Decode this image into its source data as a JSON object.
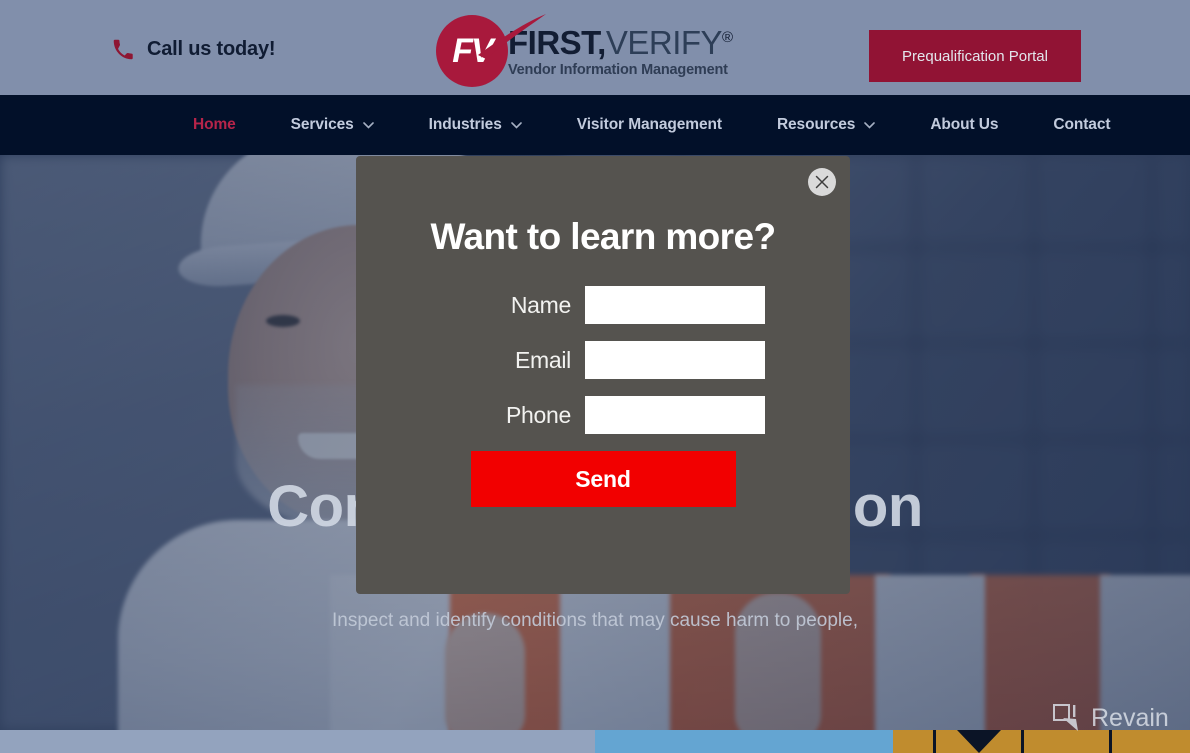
{
  "topbar": {
    "phone_icon": "phone-icon",
    "call_text": "Call us today!",
    "logo": {
      "badge_text": "FV",
      "line1_first": "FIRST,",
      "line1_second": "VERIFY",
      "registered": "®",
      "line2": "Vendor Information Management"
    },
    "prequalification_button": "Prequalification Portal"
  },
  "nav": {
    "items": [
      {
        "label": "Home",
        "has_dropdown": false,
        "active": true
      },
      {
        "label": "Services",
        "has_dropdown": true,
        "active": false
      },
      {
        "label": "Industries",
        "has_dropdown": true,
        "active": false
      },
      {
        "label": "Visitor Management",
        "has_dropdown": false,
        "active": false
      },
      {
        "label": "Resources",
        "has_dropdown": true,
        "active": false
      },
      {
        "label": "About Us",
        "has_dropdown": false,
        "active": false
      },
      {
        "label": "Contact",
        "has_dropdown": false,
        "active": false
      }
    ]
  },
  "hero": {
    "title": "Construction Inspection",
    "subtitle": "Inspect and identify conditions that may cause harm to people,"
  },
  "modal": {
    "title": "Want to learn more?",
    "close_icon": "close-icon",
    "fields": [
      {
        "label": "Name",
        "value": "",
        "placeholder": ""
      },
      {
        "label": "Email",
        "value": "",
        "placeholder": ""
      },
      {
        "label": "Phone",
        "value": "",
        "placeholder": ""
      }
    ],
    "submit_label": "Send"
  },
  "watermark": {
    "icon": "revain-logo-icon",
    "text": "Revain"
  },
  "colors": {
    "topbar_bg": "#818fab",
    "nav_bg": "#021029",
    "brand_red": "#911334",
    "nav_active": "#b6244a",
    "modal_bg": "#55534f",
    "send_red": "#f20000",
    "strip_a": "#93a3be",
    "strip_b": "#64a5d2",
    "strip_c": "#c08c2e"
  }
}
